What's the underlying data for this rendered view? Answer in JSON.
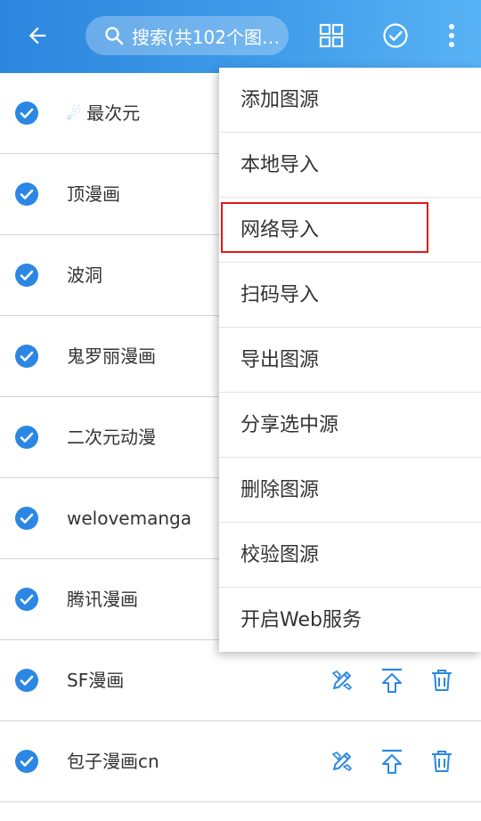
{
  "appbar": {
    "search_placeholder": "搜索(共102个图…"
  },
  "colors": {
    "accent": "#2c86de",
    "check": "#2b87e3",
    "highlight": "#e01818"
  },
  "sources": [
    {
      "name": "最次元",
      "prefix_icon": "comet-icon",
      "checked": true
    },
    {
      "name": "顶漫画",
      "checked": true
    },
    {
      "name": "波洞",
      "checked": true
    },
    {
      "name": "鬼罗丽漫画",
      "checked": true
    },
    {
      "name": "二次元动漫",
      "checked": true
    },
    {
      "name": "welovemanga",
      "checked": true
    },
    {
      "name": "腾讯漫画",
      "checked": true
    },
    {
      "name": "SF漫画",
      "checked": true
    },
    {
      "name": "包子漫画cn",
      "checked": true
    }
  ],
  "menu": {
    "items": [
      {
        "label": "添加图源"
      },
      {
        "label": "本地导入"
      },
      {
        "label": "网络导入",
        "highlighted": true
      },
      {
        "label": "扫码导入"
      },
      {
        "label": "导出图源"
      },
      {
        "label": "分享选中源"
      },
      {
        "label": "删除图源"
      },
      {
        "label": "校验图源"
      },
      {
        "label": "开启Web服务"
      }
    ]
  }
}
